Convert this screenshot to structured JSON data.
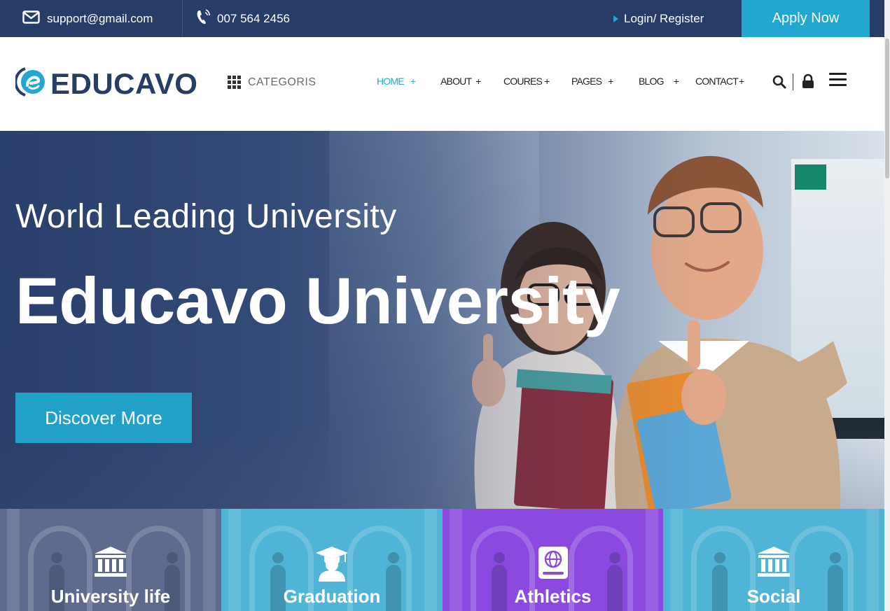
{
  "topbar": {
    "email": "support@gmail.com",
    "phone": "007 564 2456",
    "login": "Login/ Register",
    "apply": "Apply Now"
  },
  "header": {
    "logo": "EDUCAVO",
    "categories": "CATEGORIS",
    "nav": [
      {
        "label": "HOME",
        "plus": "+"
      },
      {
        "label": "ABOUT",
        "plus": "+"
      },
      {
        "label": "COURES",
        "plus": "+"
      },
      {
        "label": "PAGES",
        "plus": "+"
      },
      {
        "label": "BLOG",
        "plus": "+"
      },
      {
        "label": "CONTACT",
        "plus": "+"
      }
    ]
  },
  "hero": {
    "subtitle": "World Leading University",
    "title": "Educavo University",
    "button": "Discover More"
  },
  "features": [
    {
      "label": "University life",
      "icon": "university-icon",
      "color": "#5e6b8f"
    },
    {
      "label": "Graduation",
      "icon": "graduation-icon",
      "color": "#4fb4d6"
    },
    {
      "label": "Athletics",
      "icon": "book-globe-icon",
      "color": "#8b49e0"
    },
    {
      "label": "Social",
      "icon": "university-icon",
      "color": "#4fb4d6"
    }
  ],
  "colors": {
    "topbar": "#273c66",
    "accent": "#21a7d0"
  }
}
